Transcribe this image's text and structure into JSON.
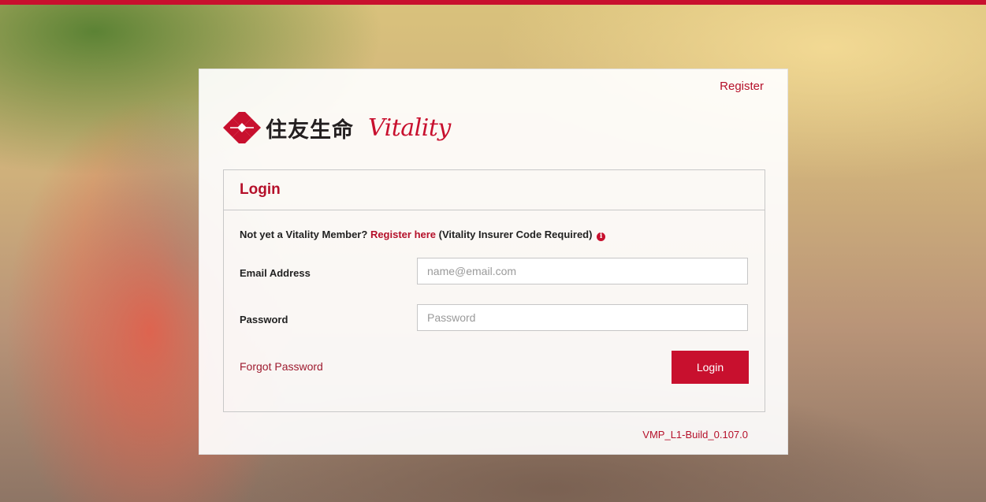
{
  "header": {
    "register_label": "Register"
  },
  "logo": {
    "japanese": "住友生命",
    "brand": "Vitality"
  },
  "login_panel": {
    "title": "Login",
    "member_prefix": "Not yet a Vitality Member?",
    "member_link": "Register here",
    "member_suffix": "(Vitality Insurer Code Required)",
    "info_icon": "i",
    "email_label": "Email Address",
    "email_placeholder": "name@email.com",
    "password_label": "Password",
    "password_placeholder": "Password",
    "forgot_label": "Forgot Password",
    "login_button": "Login"
  },
  "footer": {
    "build": "VMP_L1-Build_0.107.0"
  },
  "colors": {
    "accent": "#c8102e",
    "link": "#b5102a"
  }
}
